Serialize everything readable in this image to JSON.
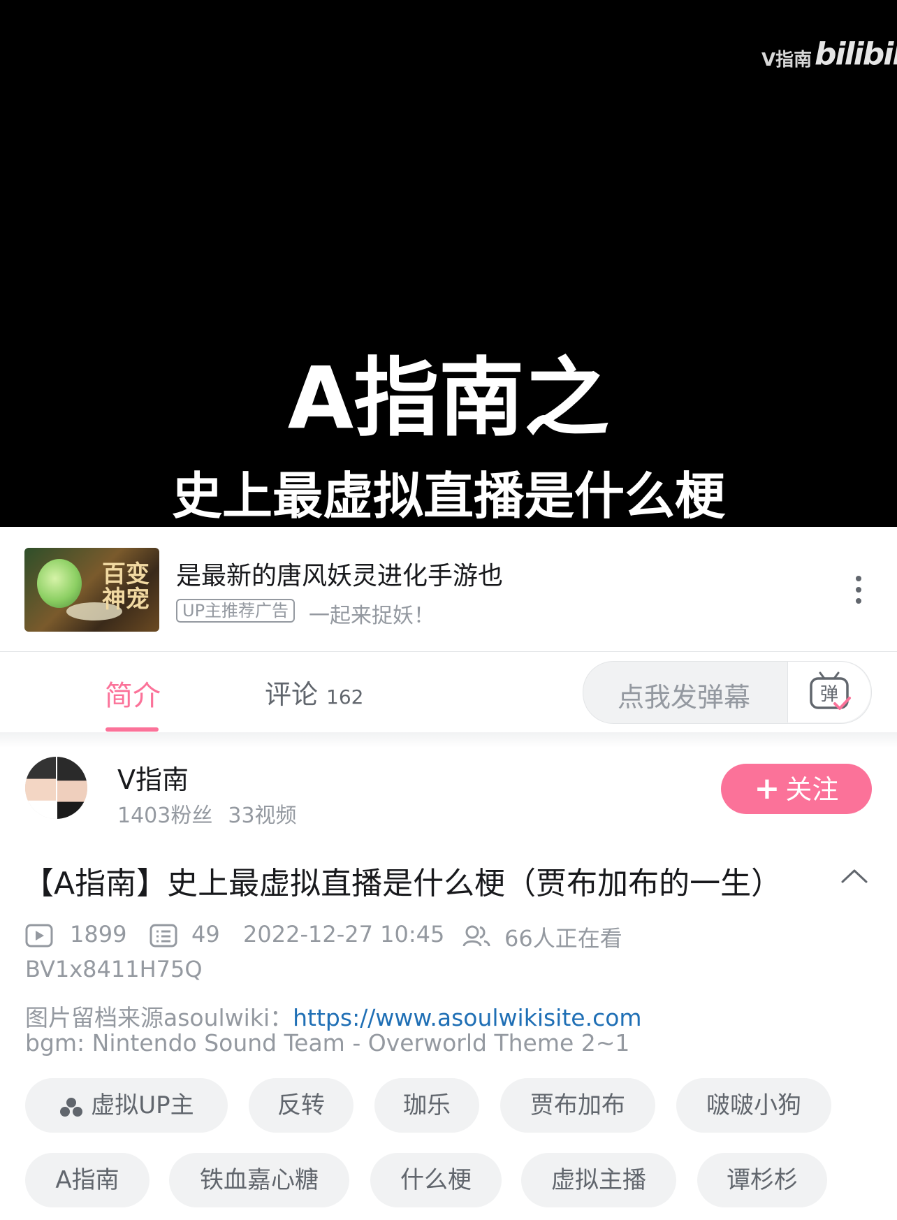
{
  "player": {
    "watermark_text": "V指南",
    "watermark_logo": "bilibili",
    "cover_title": "A指南之",
    "cover_subtitle": "史上最虚拟直播是什么梗"
  },
  "ad": {
    "thumb_text": "百变神宠",
    "title": "是最新的唐风妖灵进化手游也",
    "badge": "UP主推荐广告",
    "slogan": "一起来捉妖！",
    "more_icon": "more-vertical-icon"
  },
  "tabs": {
    "intro": "简介",
    "comments_label": "评论",
    "comments_count": "162",
    "active": "intro"
  },
  "danmaku": {
    "placeholder": "点我发弹幕",
    "toggle_icon": "danmaku-toggle-icon",
    "toggle_glyph": "弹"
  },
  "uploader": {
    "name": "V指南",
    "fans": "1403粉丝",
    "videos": "33视频",
    "follow_label": "关注"
  },
  "video": {
    "title": "【A指南】史上最虚拟直播是什么梗（贾布加布的一生）",
    "plays": "1899",
    "danmaku_count": "49",
    "publish_time": "2022-12-27 10:45",
    "watching": "66人正在看",
    "bvid": "BV1x8411H75Q",
    "desc_prefix": "图片留档来源asoulwiki：",
    "desc_link": "https://www.asoulwikisite.com",
    "desc_line2": "bgm: Nintendo Sound Team - Overworld Theme 2~1"
  },
  "tags": [
    "虚拟UP主",
    "反转",
    "珈乐",
    "贾布加布",
    "啵啵小狗",
    "A指南",
    "铁血嘉心糖",
    "什么梗",
    "虚拟主播",
    "谭杉杉"
  ],
  "colors": {
    "accent": "#fb7299",
    "link": "#1f6fb5",
    "muted": "#9499a0",
    "tag_bg": "#f1f2f3"
  }
}
